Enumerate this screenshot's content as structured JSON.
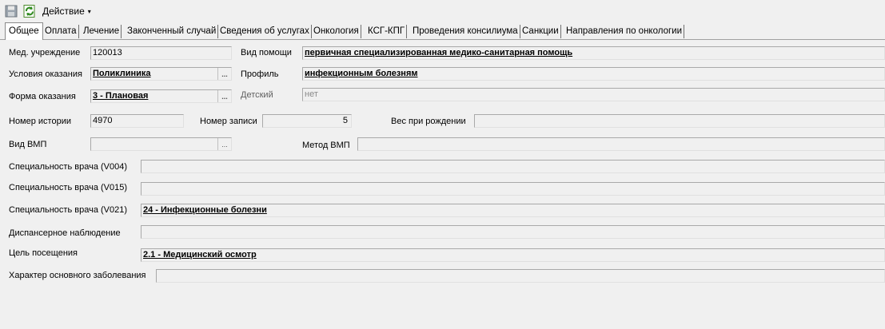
{
  "toolbar": {
    "save_icon": "save-icon",
    "refresh_icon": "refresh-icon",
    "action_label": "Действие",
    "action_arrow": "▾"
  },
  "tabs": [
    {
      "label": "Общее",
      "active": true
    },
    {
      "label": "Оплата"
    },
    {
      "label": "Лечение"
    },
    {
      "label": "Законченный случай"
    },
    {
      "label": "Сведения об услугах"
    },
    {
      "label": "Онкология"
    },
    {
      "label": "КСГ-КПГ"
    },
    {
      "label": "Проведения консилиума"
    },
    {
      "label": "Санкции"
    },
    {
      "label": "Направления по онкологии"
    }
  ],
  "form": {
    "med_uchr_label": "Мед. учреждение",
    "med_uchr_value": "120013",
    "vid_pomoshi_label": "Вид помощи",
    "vid_pomoshi_value": "первичная специализированная медико-санитарная помощь",
    "usloviya_label": "Условия оказания",
    "usloviya_value": "Поликлиника",
    "profil_label": "Профиль",
    "profil_value": "инфекционным болезням",
    "forma_label": "Форма оказания",
    "forma_value": "3 - Плановая",
    "detskiy_label": "Детский",
    "detskiy_value": "нет",
    "nomer_istorii_label": "Номер истории",
    "nomer_istorii_value": "4970",
    "nomer_zapisi_label": "Номер записи",
    "nomer_zapisi_value": "5",
    "ves_label": "Вес при рождении",
    "ves_value": "",
    "vid_vmp_label": "Вид ВМП",
    "vid_vmp_value": "",
    "metod_vmp_label": "Метод ВМП",
    "metod_vmp_value": "",
    "spec_v004_label": "Специальность врача (V004)",
    "spec_v004_value": "",
    "spec_v015_label": "Специальность врача (V015)",
    "spec_v015_value": "",
    "spec_v021_label": "Специальность врача (V021)",
    "spec_v021_value": "24 - Инфекционные болезни",
    "disp_label": "Диспансерное наблюдение",
    "disp_value": "",
    "cel_label": "Цель посещения",
    "cel_value": "2.1 - Медицинский осмотр",
    "harakter_label": "Характер основного заболевания",
    "harakter_value": "",
    "dots": "..."
  }
}
